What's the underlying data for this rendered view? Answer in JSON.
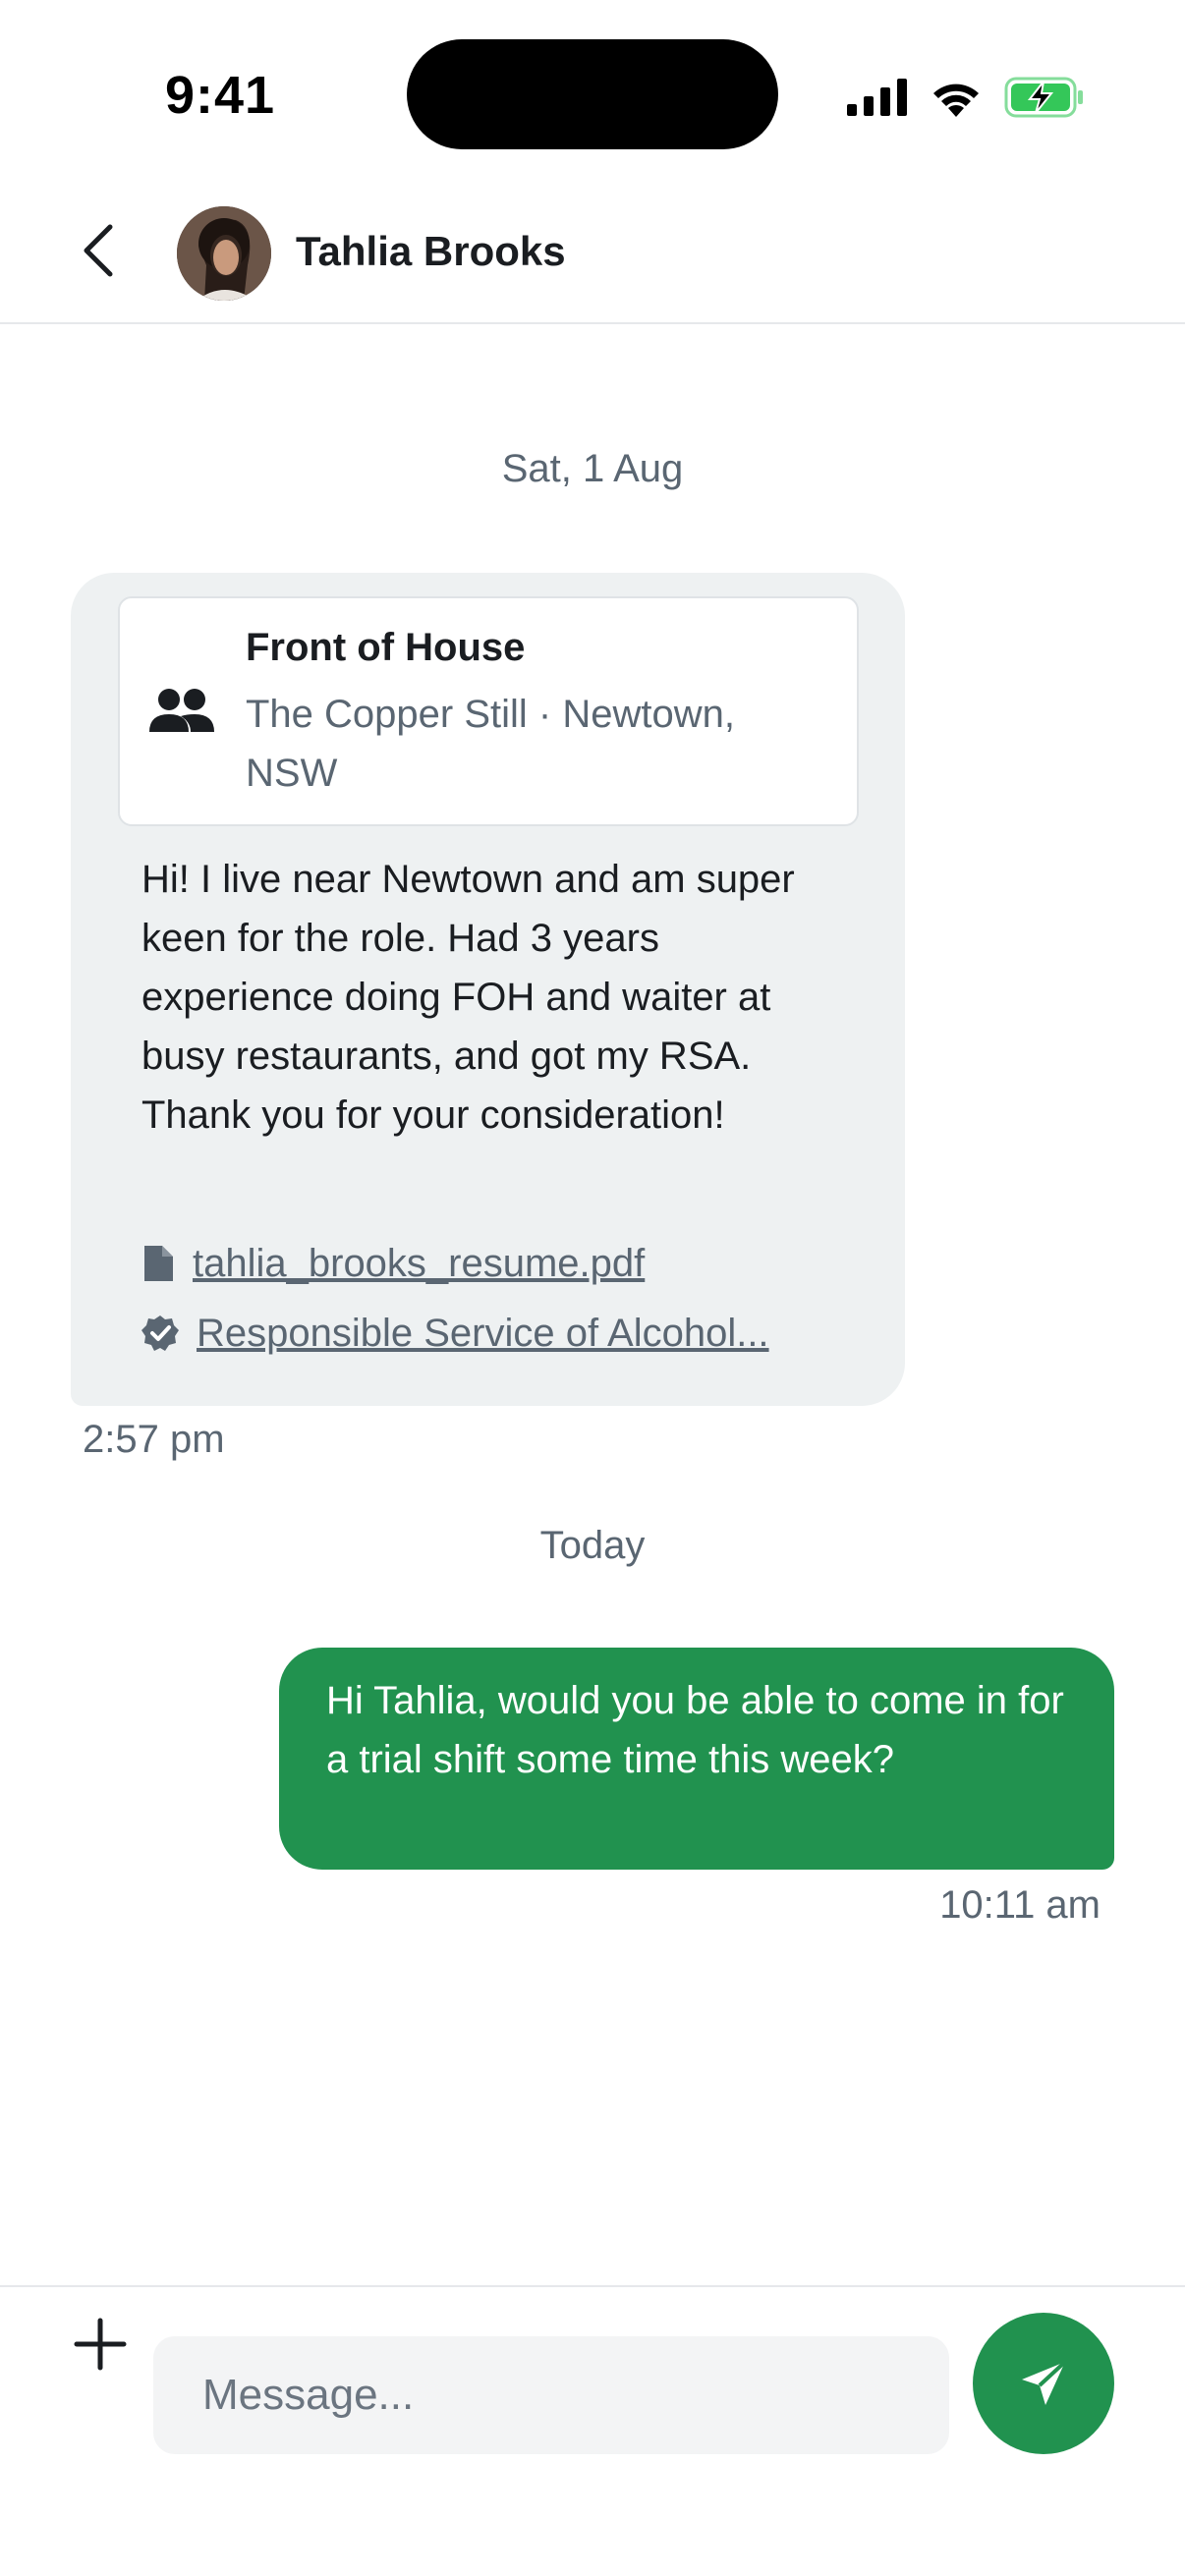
{
  "status_bar": {
    "time": "9:41",
    "icons": [
      "signal-icon",
      "wifi-icon",
      "battery-charging-icon"
    ],
    "battery_color": "#34c759"
  },
  "header": {
    "back_icon": "chevron-left-icon",
    "contact_name": "Tahlia Brooks"
  },
  "conversation": {
    "date_1": "Sat, 1 Aug",
    "incoming": {
      "job_card": {
        "icon": "people-icon",
        "title": "Front of House",
        "subtitle": "The Copper Still · Newtown, NSW"
      },
      "text": "Hi! I live near Newtown and am super keen for the role. Had 3 years experience doing FOH and waiter at busy restaurants, and got my RSA. Thank you for your consideration!",
      "attachments": [
        {
          "icon": "file-icon",
          "label": "tahlia_brooks_resume.pdf"
        },
        {
          "icon": "verified-badge-icon",
          "label": "Responsible Service of Alcohol..."
        }
      ],
      "time": "2:57 pm"
    },
    "date_2": "Today",
    "outgoing": {
      "text": "Hi Tahlia, would you be able to come in for a trial shift some time this week?",
      "time": "10:11 am"
    }
  },
  "composer": {
    "plus_icon": "plus-icon",
    "placeholder": "Message...",
    "value": "",
    "send_icon": "send-icon",
    "accent_color": "#21924f"
  }
}
